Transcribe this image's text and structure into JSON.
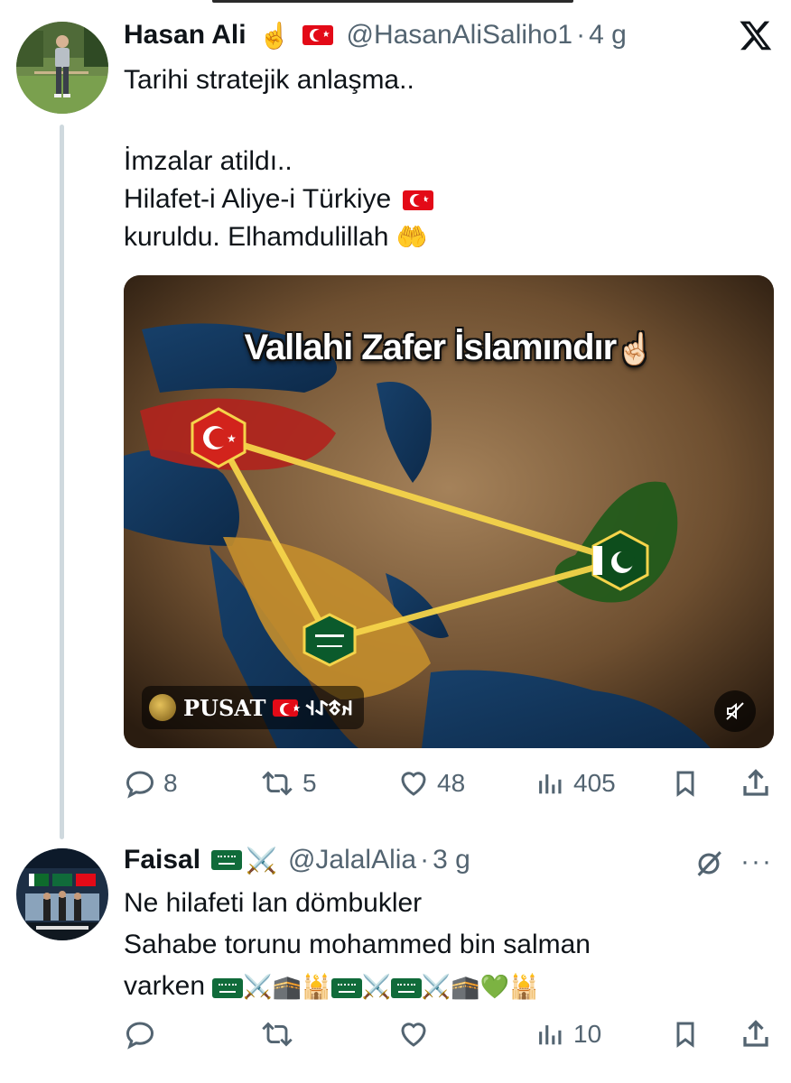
{
  "tweet1": {
    "name": "Hasan Ali",
    "handle": "@HasanAliSaliho1",
    "time": "4 g",
    "text_lines": [
      "Tarihi stratejik anlaşma..",
      "",
      "İmzalar atildı..",
      "Hilafet-i Aliye-i Türkiye 🇹🇷",
      "kuruldu. Elhamdulillah 🤲"
    ],
    "line1": "Tarihi stratejik anlaşma..",
    "line2": "İmzalar atildı..",
    "line3": "Hilafet-i Aliye-i Türkiye",
    "line4": "kuruldu. Elhamdulillah",
    "media": {
      "title": "Vallahi Zafer İslamındır",
      "watermark": "PUSAT",
      "watermark_runes": "𐰴𐱃𐰀𐰭",
      "icon_mute": "mute-icon"
    },
    "stats": {
      "replies": "8",
      "retweets": "5",
      "likes": "48",
      "views": "405"
    }
  },
  "tweet2": {
    "name": "Faisal",
    "handle": "@JalalAlia",
    "time": "3 g",
    "line1": "Ne hilafeti lan dömbukler",
    "line2": "Sahabe torunu mohammed bin salman",
    "line3": "varken",
    "stats": {
      "replies": "",
      "retweets": "",
      "likes": "",
      "views": "10"
    }
  },
  "icons": [
    "x-logo-icon",
    "reply-icon",
    "retweet-icon",
    "like-icon",
    "views-icon",
    "bookmark-icon",
    "share-icon",
    "grok-icon",
    "more-icon"
  ],
  "colors": {
    "text": "#0f1419",
    "secondary": "#536471",
    "thread": "#cfd9de"
  }
}
